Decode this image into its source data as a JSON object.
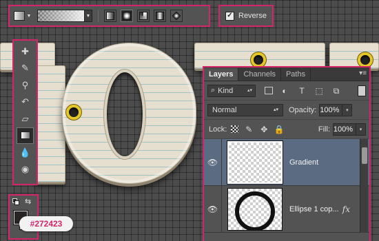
{
  "options_bar": {
    "tool_preset_icon": "gradient-tool-preset-icon",
    "gradient_type_icons": [
      "linear-gradient-icon",
      "radial-gradient-icon",
      "angle-gradient-icon",
      "reflected-gradient-icon",
      "diamond-gradient-icon"
    ],
    "selected_gradient_type": "radial-gradient-icon"
  },
  "reverse": {
    "label": "Reverse",
    "checked": true,
    "check_glyph": "✓"
  },
  "tools": [
    {
      "name": "spot-healing-brush-icon",
      "glyph": "✚"
    },
    {
      "name": "brush-icon",
      "glyph": "✎"
    },
    {
      "name": "clone-stamp-icon",
      "glyph": "⚲"
    },
    {
      "name": "history-brush-icon",
      "glyph": "↶"
    },
    {
      "name": "eraser-icon",
      "glyph": "▱"
    },
    {
      "name": "gradient-tool-icon",
      "glyph": ""
    },
    {
      "name": "blur-icon",
      "glyph": "💧"
    },
    {
      "name": "dodge-icon",
      "glyph": "◉"
    }
  ],
  "colors": {
    "foreground": "#272423",
    "background": "#ffffff",
    "swap_glyph": "⇆",
    "hex_callout": "#272423",
    "callout_color": "#d4256b"
  },
  "layers_panel": {
    "tabs": [
      "Layers",
      "Channels",
      "Paths"
    ],
    "active_tab": "Layers",
    "menu_glyph": "▾≡",
    "filter": {
      "value": "Kind",
      "search_glyph": "⌕",
      "caret": "▴▾"
    },
    "filter_icons": [
      {
        "name": "pixel-layer-filter-icon",
        "glyph": ""
      },
      {
        "name": "adjustment-layer-filter-icon",
        "glyph": "◐"
      },
      {
        "name": "type-layer-filter-icon",
        "glyph": "T"
      },
      {
        "name": "shape-layer-filter-icon",
        "glyph": "⬚"
      },
      {
        "name": "smart-object-filter-icon",
        "glyph": "⧉"
      }
    ],
    "blend_mode": "Normal",
    "opacity_label": "Opacity:",
    "opacity_value": "100%",
    "lock_label": "Lock:",
    "lock_icons": [
      {
        "name": "lock-transparent-pixels-icon",
        "glyph": ""
      },
      {
        "name": "lock-image-pixels-icon",
        "glyph": "✎"
      },
      {
        "name": "lock-position-icon",
        "glyph": "✥"
      },
      {
        "name": "lock-all-icon",
        "glyph": "🔒"
      }
    ],
    "fill_label": "Fill:",
    "fill_value": "100%",
    "dropdown_caret": "▾",
    "layers": [
      {
        "name": "Gradient",
        "visible_glyph": "👁",
        "selected": true,
        "fx": ""
      },
      {
        "name": "Ellipse 1 cop...",
        "visible_glyph": "👁",
        "selected": false,
        "fx": "fx"
      }
    ]
  },
  "accent_color": "#d4256b",
  "selection_color": "#5b6b82"
}
